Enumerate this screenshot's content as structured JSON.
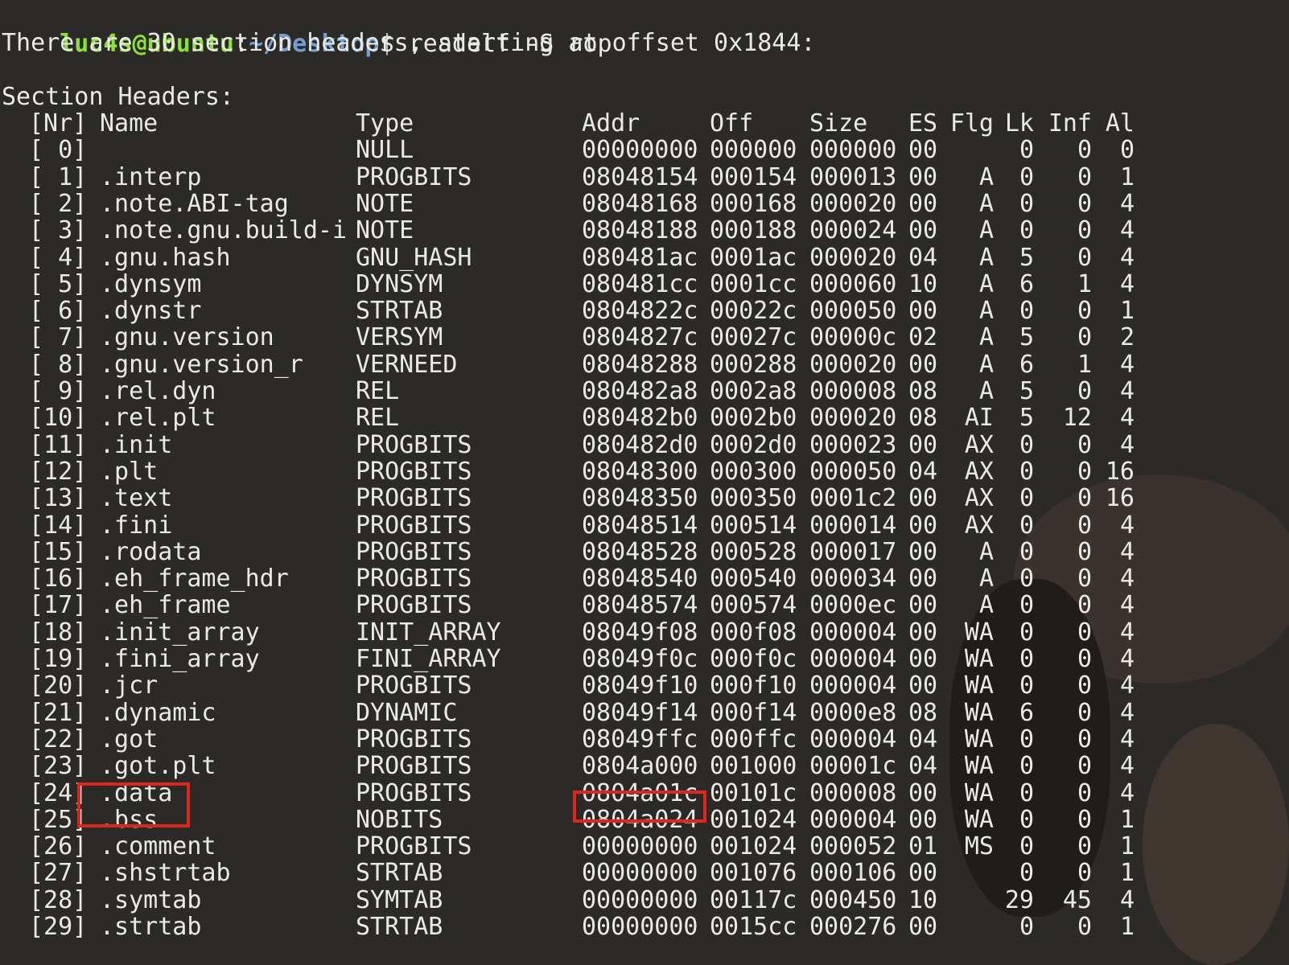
{
  "terminal": {
    "prompt_user": "luc4s@ubuntu",
    "prompt_colon": ":",
    "prompt_path": "~/Desktop",
    "prompt_symbol": "$ ",
    "command": "readelf -S rop",
    "summary": "There are 30 section headers, starting at offset 0x1844:",
    "section_title": "Section Headers:",
    "columns": [
      "[Nr]",
      "Name",
      "Type",
      "Addr",
      "Off",
      "Size",
      "ES",
      "Flg",
      "Lk",
      "Inf",
      "Al"
    ],
    "rows": [
      [
        "[ 0]",
        "",
        "NULL",
        "00000000",
        "000000",
        "000000",
        "00",
        "",
        "0",
        "0",
        "0"
      ],
      [
        "[ 1]",
        ".interp",
        "PROGBITS",
        "08048154",
        "000154",
        "000013",
        "00",
        "A",
        "0",
        "0",
        "1"
      ],
      [
        "[ 2]",
        ".note.ABI-tag",
        "NOTE",
        "08048168",
        "000168",
        "000020",
        "00",
        "A",
        "0",
        "0",
        "4"
      ],
      [
        "[ 3]",
        ".note.gnu.build-i",
        "NOTE",
        "08048188",
        "000188",
        "000024",
        "00",
        "A",
        "0",
        "0",
        "4"
      ],
      [
        "[ 4]",
        ".gnu.hash",
        "GNU_HASH",
        "080481ac",
        "0001ac",
        "000020",
        "04",
        "A",
        "5",
        "0",
        "4"
      ],
      [
        "[ 5]",
        ".dynsym",
        "DYNSYM",
        "080481cc",
        "0001cc",
        "000060",
        "10",
        "A",
        "6",
        "1",
        "4"
      ],
      [
        "[ 6]",
        ".dynstr",
        "STRTAB",
        "0804822c",
        "00022c",
        "000050",
        "00",
        "A",
        "0",
        "0",
        "1"
      ],
      [
        "[ 7]",
        ".gnu.version",
        "VERSYM",
        "0804827c",
        "00027c",
        "00000c",
        "02",
        "A",
        "5",
        "0",
        "2"
      ],
      [
        "[ 8]",
        ".gnu.version_r",
        "VERNEED",
        "08048288",
        "000288",
        "000020",
        "00",
        "A",
        "6",
        "1",
        "4"
      ],
      [
        "[ 9]",
        ".rel.dyn",
        "REL",
        "080482a8",
        "0002a8",
        "000008",
        "08",
        "A",
        "5",
        "0",
        "4"
      ],
      [
        "[10]",
        ".rel.plt",
        "REL",
        "080482b0",
        "0002b0",
        "000020",
        "08",
        "AI",
        "5",
        "12",
        "4"
      ],
      [
        "[11]",
        ".init",
        "PROGBITS",
        "080482d0",
        "0002d0",
        "000023",
        "00",
        "AX",
        "0",
        "0",
        "4"
      ],
      [
        "[12]",
        ".plt",
        "PROGBITS",
        "08048300",
        "000300",
        "000050",
        "04",
        "AX",
        "0",
        "0",
        "16"
      ],
      [
        "[13]",
        ".text",
        "PROGBITS",
        "08048350",
        "000350",
        "0001c2",
        "00",
        "AX",
        "0",
        "0",
        "16"
      ],
      [
        "[14]",
        ".fini",
        "PROGBITS",
        "08048514",
        "000514",
        "000014",
        "00",
        "AX",
        "0",
        "0",
        "4"
      ],
      [
        "[15]",
        ".rodata",
        "PROGBITS",
        "08048528",
        "000528",
        "000017",
        "00",
        "A",
        "0",
        "0",
        "4"
      ],
      [
        "[16]",
        ".eh_frame_hdr",
        "PROGBITS",
        "08048540",
        "000540",
        "000034",
        "00",
        "A",
        "0",
        "0",
        "4"
      ],
      [
        "[17]",
        ".eh_frame",
        "PROGBITS",
        "08048574",
        "000574",
        "0000ec",
        "00",
        "A",
        "0",
        "0",
        "4"
      ],
      [
        "[18]",
        ".init_array",
        "INIT_ARRAY",
        "08049f08",
        "000f08",
        "000004",
        "00",
        "WA",
        "0",
        "0",
        "4"
      ],
      [
        "[19]",
        ".fini_array",
        "FINI_ARRAY",
        "08049f0c",
        "000f0c",
        "000004",
        "00",
        "WA",
        "0",
        "0",
        "4"
      ],
      [
        "[20]",
        ".jcr",
        "PROGBITS",
        "08049f10",
        "000f10",
        "000004",
        "00",
        "WA",
        "0",
        "0",
        "4"
      ],
      [
        "[21]",
        ".dynamic",
        "DYNAMIC",
        "08049f14",
        "000f14",
        "0000e8",
        "08",
        "WA",
        "6",
        "0",
        "4"
      ],
      [
        "[22]",
        ".got",
        "PROGBITS",
        "08049ffc",
        "000ffc",
        "000004",
        "04",
        "WA",
        "0",
        "0",
        "4"
      ],
      [
        "[23]",
        ".got.plt",
        "PROGBITS",
        "0804a000",
        "001000",
        "00001c",
        "04",
        "WA",
        "0",
        "0",
        "4"
      ],
      [
        "[24]",
        ".data",
        "PROGBITS",
        "0804a01c",
        "00101c",
        "000008",
        "00",
        "WA",
        "0",
        "0",
        "4"
      ],
      [
        "[25]",
        ".bss",
        "NOBITS",
        "0804a024",
        "001024",
        "000004",
        "00",
        "WA",
        "0",
        "0",
        "1"
      ],
      [
        "[26]",
        ".comment",
        "PROGBITS",
        "00000000",
        "001024",
        "000052",
        "01",
        "MS",
        "0",
        "0",
        "1"
      ],
      [
        "[27]",
        ".shstrtab",
        "STRTAB",
        "00000000",
        "001076",
        "000106",
        "00",
        "",
        "0",
        "0",
        "1"
      ],
      [
        "[28]",
        ".symtab",
        "SYMTAB",
        "00000000",
        "00117c",
        "000450",
        "10",
        "",
        "29",
        "45",
        "4"
      ],
      [
        "[29]",
        ".strtab",
        "STRTAB",
        "00000000",
        "0015cc",
        "000276",
        "00",
        "",
        "0",
        "0",
        "1"
      ]
    ],
    "highlight_row": 25,
    "highlight_color": "#e1251b",
    "colors": {
      "background": "#2c2a27",
      "text": "#e9e9e7",
      "prompt_user": "#8ae234",
      "prompt_path": "#729fcf"
    }
  }
}
